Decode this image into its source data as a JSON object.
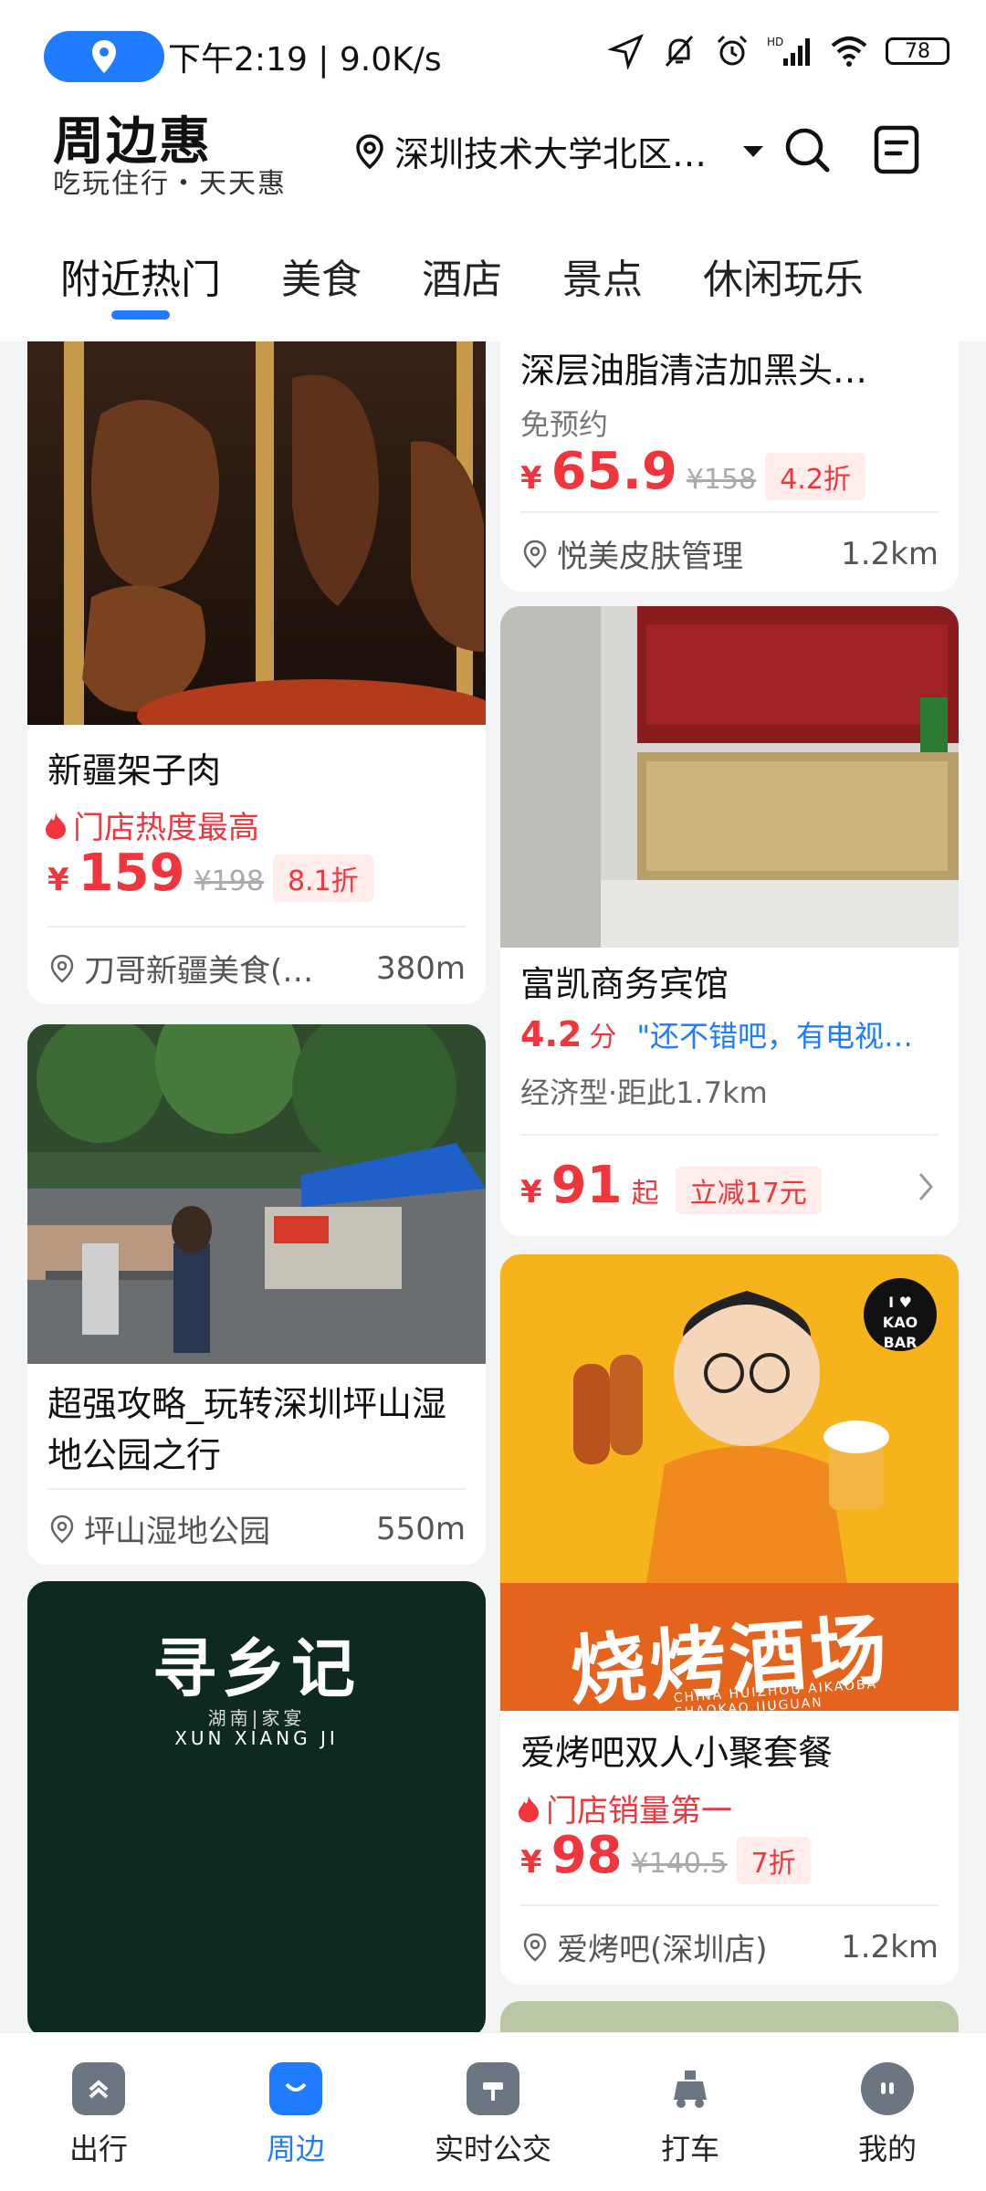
{
  "status_bar": {
    "time_speed": "下午2:19 | 9.0K/s",
    "battery": "78"
  },
  "header": {
    "brand": "周边惠",
    "slogan": "吃玩住行・天天惠",
    "location": "深圳技术大学北区…"
  },
  "tabs": [
    "附近热门",
    "美食",
    "酒店",
    "景点",
    "休闲玩乐"
  ],
  "feed": {
    "card_skin": {
      "title": "深层油脂清洁加黑头…",
      "tag": "免预约",
      "price": "65.9",
      "orig_price": "¥158",
      "discount": "4.2折",
      "shop": "悦美皮肤管理",
      "distance": "1.2km"
    },
    "card_xinjiang": {
      "title": "新疆架子肉",
      "hot": "门店热度最高",
      "price": "159",
      "orig_price": "¥198",
      "discount": "8.1折",
      "shop": "刀哥新疆美食(…",
      "distance": "380m"
    },
    "card_hotel": {
      "title": "富凯商务宾馆",
      "score": "4.2",
      "score_unit": "分",
      "review": "\"还不错吧，有电视…",
      "meta": "经济型·距此1.7km",
      "price": "91",
      "price_suffix": "起",
      "promo": "立减17元"
    },
    "card_park": {
      "title": "超强攻略_玩转深圳坪山湿地公园之行",
      "shop": "坪山湿地公园",
      "distance": "550m"
    },
    "card_bbq": {
      "poster_text": "烧烤酒场",
      "poster_sub": "CHINA HUIZHOU AIKAOBA SHAOKAO JIUGUAN",
      "badge_line1": "I ♥",
      "badge_line2": "KAO BAR",
      "title": "爱烤吧双人小聚套餐",
      "hot": "门店销量第一",
      "price": "98",
      "orig_price": "¥140.5",
      "discount": "7折",
      "shop": "爱烤吧(深圳店)",
      "distance": "1.2km"
    },
    "card_xunxiang": {
      "logo": "寻乡记",
      "logo_sub": "湖南|家宴",
      "logo_en": "XUN XIANG JI"
    }
  },
  "currency": "¥",
  "bottom_nav": [
    {
      "label": "出行"
    },
    {
      "label": "周边"
    },
    {
      "label": "实时公交"
    },
    {
      "label": "打车"
    },
    {
      "label": "我的"
    }
  ],
  "colors": {
    "accent": "#1f7bff",
    "price": "#f0363c",
    "review": "#1f7bff"
  }
}
